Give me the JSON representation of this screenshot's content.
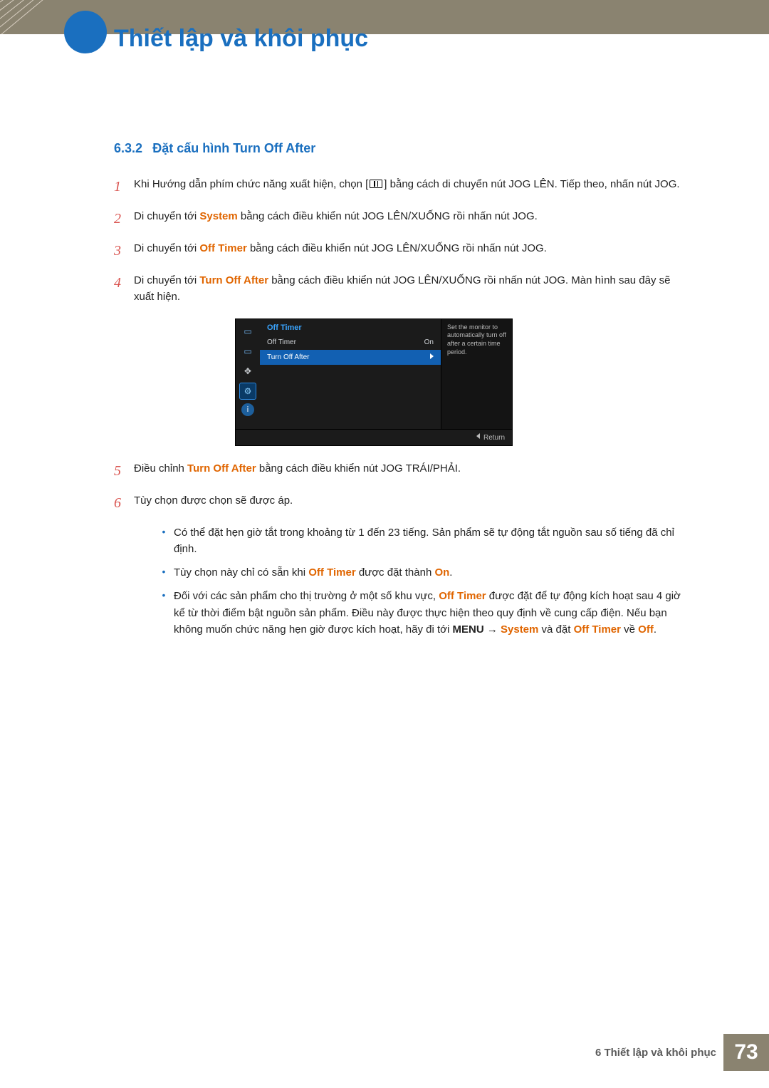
{
  "header": {
    "chapter_title": "Thiết lập và khôi phục"
  },
  "section": {
    "number": "6.3.2",
    "title": "Đặt cấu hình Turn Off After"
  },
  "steps": {
    "s1": {
      "num": "1",
      "pre": "Khi Hướng dẫn phím chức năng xuất hiện, chọn [",
      "post": "] bằng cách di chuyển nút JOG LÊN. Tiếp theo, nhấn nút JOG."
    },
    "s2": {
      "num": "2",
      "pre": "Di chuyển tới ",
      "kw": "System",
      "post": " bằng cách điều khiển nút JOG LÊN/XUỐNG rồi nhấn nút JOG."
    },
    "s3": {
      "num": "3",
      "pre": "Di chuyển tới ",
      "kw": "Off Timer",
      "post": " bằng cách điều khiển nút JOG LÊN/XUỐNG rồi nhấn nút JOG."
    },
    "s4": {
      "num": "4",
      "pre": "Di chuyển tới ",
      "kw": "Turn Off After",
      "post": " bằng cách điều khiển nút JOG LÊN/XUỐNG rồi nhấn nút JOG. Màn hình sau đây sẽ xuất hiện."
    },
    "s5": {
      "num": "5",
      "pre": "Điều chỉnh ",
      "kw": "Turn Off After",
      "post": " bằng cách điều khiển nút JOG TRÁI/PHẢI."
    },
    "s6": {
      "num": "6",
      "text": "Tùy chọn được chọn sẽ được áp."
    }
  },
  "osd": {
    "title": "Off Timer",
    "row1_label": "Off Timer",
    "row1_value": "On",
    "row2_label": "Turn Off After",
    "help": "Set the monitor to automatically turn off after a certain time period.",
    "return": "Return"
  },
  "bullets": {
    "b1": "Có thể đặt hẹn giờ tắt trong khoảng từ 1 đến 23 tiếng. Sản phẩm sẽ tự động tắt nguồn sau số tiếng đã chỉ định.",
    "b2_pre": "Tùy chọn này chỉ có sẵn khi ",
    "b2_kw1": "Off Timer",
    "b2_mid": " được đặt thành ",
    "b2_kw2": "On",
    "b2_post": ".",
    "b3_pre": "Đối với các sản phẩm cho thị trường ở một số khu vực, ",
    "b3_kw1": "Off Timer",
    "b3_mid1": " được đặt để tự động kích hoạt sau 4 giờ kể từ thời điểm bật nguồn sản phẩm. Điều này được thực hiện theo quy định về cung cấp điện. Nếu bạn không muốn chức năng hẹn giờ được kích hoạt, hãy đi tới ",
    "b3_menu": "MENU",
    "b3_arrow": " → ",
    "b3_kw2": "System",
    "b3_mid2": " và đặt ",
    "b3_kw3": "Off Timer",
    "b3_mid3": " về ",
    "b3_kw4": "Off",
    "b3_post": "."
  },
  "footer": {
    "text": "6 Thiết lập và khôi phục",
    "page": "73"
  }
}
